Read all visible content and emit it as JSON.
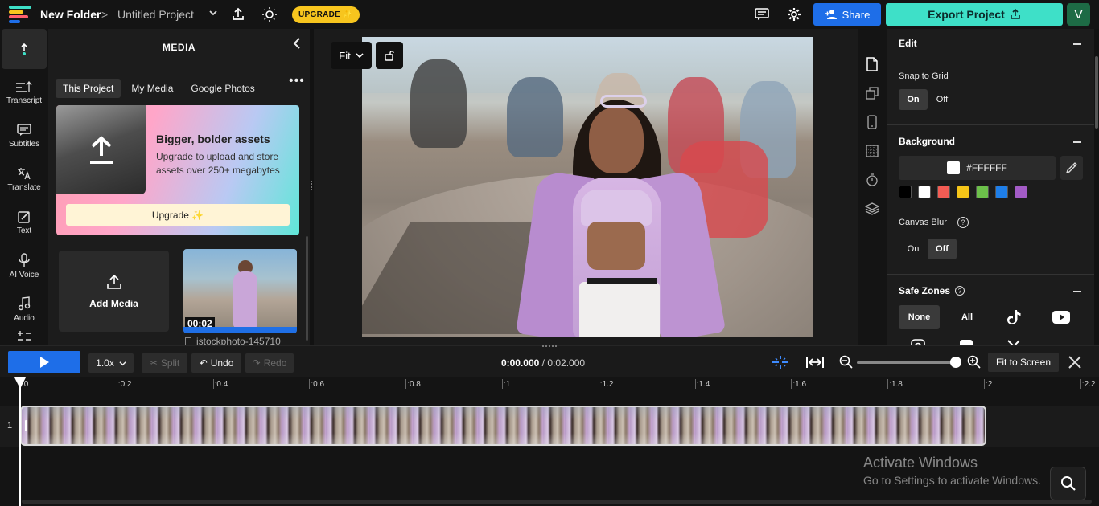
{
  "header": {
    "folder": "New Folder",
    "separator": ">",
    "project": "Untitled Project",
    "upgrade_label": "UPGRADE ✨",
    "share_label": "Share",
    "export_label": "Export Project",
    "avatar_letter": "V",
    "colors": {
      "share": "#1e6ee8",
      "export": "#3ee0c8",
      "upgrade": "#f7c51e"
    }
  },
  "rail": {
    "items": [
      {
        "label": "",
        "icon": "upload-cloud-icon"
      },
      {
        "label": "Transcript",
        "icon": "transcript-icon"
      },
      {
        "label": "Subtitles",
        "icon": "subtitles-icon"
      },
      {
        "label": "Translate",
        "icon": "translate-icon"
      },
      {
        "label": "Text",
        "icon": "text-icon"
      },
      {
        "label": "AI Voice",
        "icon": "ai-voice-icon"
      },
      {
        "label": "Audio",
        "icon": "audio-icon"
      }
    ]
  },
  "media": {
    "title": "MEDIA",
    "tabs": [
      "This Project",
      "My Media",
      "Google Photos"
    ],
    "promo": {
      "title": "Bigger, bolder assets",
      "description": "Upgrade to upload and store assets over 250+ megabytes",
      "button": "Upgrade ✨"
    },
    "add_media": "Add Media",
    "clip": {
      "duration": "00:02",
      "name": "istockphoto-145710"
    }
  },
  "canvas": {
    "fit_label": "Fit"
  },
  "props": {
    "edit": {
      "title": "Edit",
      "snap_label": "Snap to Grid",
      "on": "On",
      "off": "Off"
    },
    "background": {
      "title": "Background",
      "hex": "#FFFFFF",
      "swatches": [
        "#000000",
        "#ffffff",
        "#f25c54",
        "#f5c518",
        "#6cc04a",
        "#1e7ee8",
        "#a35bc6"
      ],
      "blur_label": "Canvas Blur",
      "on": "On",
      "off": "Off"
    },
    "safe_zones": {
      "title": "Safe Zones",
      "none": "None",
      "all": "All"
    }
  },
  "playback": {
    "speed": "1.0x",
    "split": "Split",
    "undo": "Undo",
    "redo": "Redo",
    "current": "0:00.000",
    "separator": "/",
    "total": "0:02.000",
    "fit_screen": "Fit to Screen"
  },
  "timeline": {
    "ticks": [
      ":0",
      ":0.2",
      ":0.4",
      ":0.6",
      ":0.8",
      ":1",
      ":1.2",
      ":1.4",
      ":1.6",
      ":1.8",
      ":2",
      ":2.2"
    ],
    "track_number": "1"
  },
  "watermark": {
    "line1": "Activate Windows",
    "line2": "Go to Settings to activate Windows."
  }
}
